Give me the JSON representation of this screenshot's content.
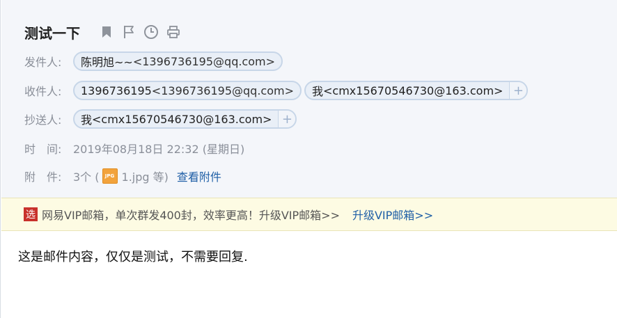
{
  "subject": "测试一下",
  "subject_icons": [
    "bookmark-icon",
    "flag-icon",
    "clock-icon",
    "print-icon"
  ],
  "from": {
    "label": "发件人:",
    "sender": {
      "name": "陈明旭~~",
      "address": "<1396736195@qq.com>"
    }
  },
  "to": {
    "label": "收件人:",
    "recipients": [
      {
        "name": "1396736195",
        "address": "<1396736195@qq.com>"
      },
      {
        "name": "我",
        "address": "<cmx15670546730@163.com>"
      }
    ],
    "add_symbol": "+"
  },
  "cc": {
    "label": "抄送人:",
    "recipients": [
      {
        "name": "我",
        "address": "<cmx15670546730@163.com>"
      }
    ],
    "add_symbol": "+"
  },
  "time": {
    "label": "时　间:",
    "value": "2019年08月18日 22:32 (星期日)"
  },
  "attachment": {
    "label": "附　件:",
    "count_prefix": "3个 (",
    "icon_text": "JPG",
    "file_text": "1.jpg 等)",
    "view_link": "查看附件"
  },
  "ad": {
    "badge": "选",
    "text": "网易VIP邮箱，单次群发400封，效率更高！升级VIP邮箱>>",
    "link": "升级VIP邮箱>>"
  },
  "body": "这是邮件内容，仅仅是测试，不需要回复."
}
